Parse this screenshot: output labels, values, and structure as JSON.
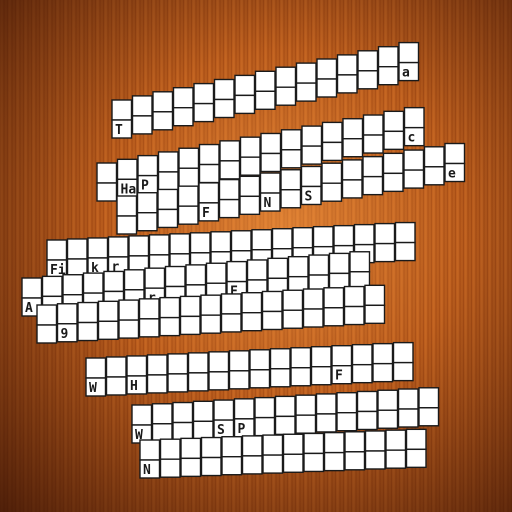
{
  "puzzle": {
    "type": "crossword",
    "theme_colors": {
      "background": "#b8601f",
      "cell_fill": "#ffffff",
      "cell_border": "#1a1a1a",
      "letter_color": "#1a1a1a"
    },
    "rows": [
      {
        "cells": 15,
        "letters": [
          {
            "col": 0,
            "char": "T"
          },
          {
            "col": 14,
            "char": "a"
          }
        ]
      },
      {
        "cells": 16,
        "letters": [
          {
            "col": 1,
            "char": "Ha"
          },
          {
            "col": 2,
            "char": "P"
          },
          {
            "col": 15,
            "char": "c"
          }
        ]
      },
      {
        "cells": 17,
        "letters": [
          {
            "col": 4,
            "char": "F"
          },
          {
            "col": 7,
            "char": "N"
          },
          {
            "col": 9,
            "char": "S"
          },
          {
            "col": 16,
            "char": "e"
          }
        ]
      },
      {
        "cells": 18,
        "letters": [
          {
            "col": 0,
            "char": "Fi"
          },
          {
            "col": 2,
            "char": "k"
          },
          {
            "col": 3,
            "char": "r"
          }
        ]
      },
      {
        "cells": 17,
        "letters": [
          {
            "col": 0,
            "char": "A"
          },
          {
            "col": 6,
            "char": "r"
          },
          {
            "col": 10,
            "char": "F"
          }
        ]
      },
      {
        "cells": 17,
        "letters": [
          {
            "col": 1,
            "char": "9"
          }
        ]
      },
      {
        "cells": 16,
        "letters": [
          {
            "col": 0,
            "char": "W"
          },
          {
            "col": 2,
            "char": "H"
          },
          {
            "col": 12,
            "char": "F"
          }
        ]
      },
      {
        "cells": 15,
        "letters": [
          {
            "col": 0,
            "char": "W"
          },
          {
            "col": 4,
            "char": "S"
          },
          {
            "col": 5,
            "char": "P"
          }
        ]
      },
      {
        "cells": 14,
        "letters": [
          {
            "col": 0,
            "char": "N"
          }
        ]
      }
    ]
  }
}
